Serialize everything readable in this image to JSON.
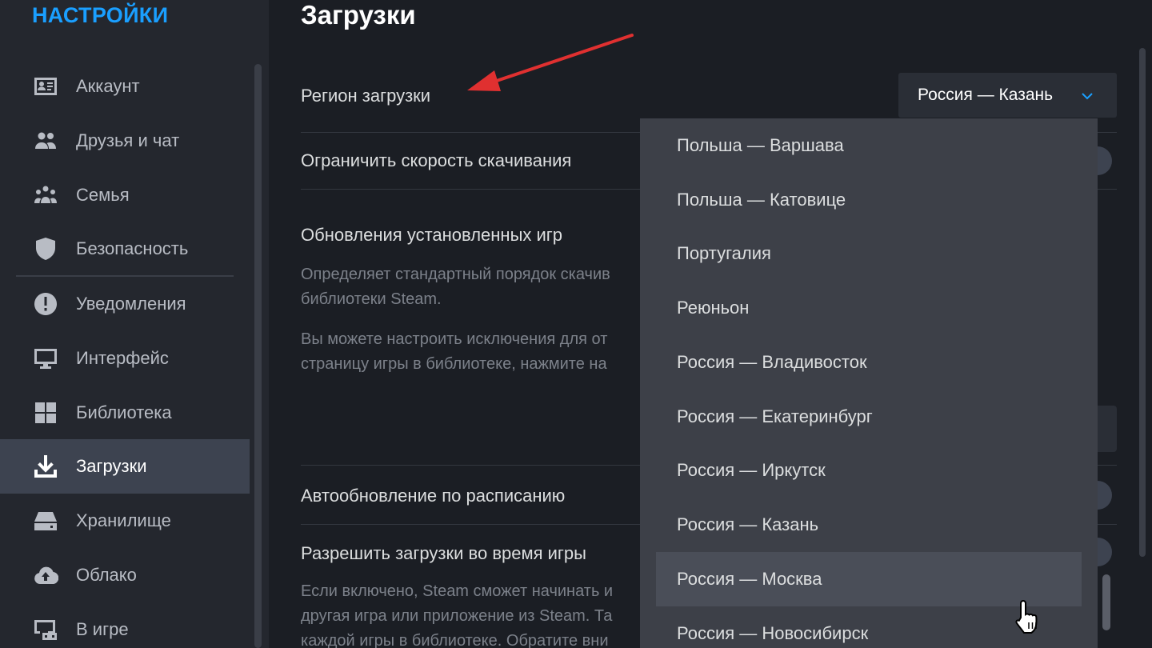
{
  "sidebar": {
    "title": "НАСТРОЙКИ",
    "items": [
      {
        "label": "Аккаунт",
        "icon": "account-card-icon"
      },
      {
        "label": "Друзья и чат",
        "icon": "friends-icon"
      },
      {
        "label": "Семья",
        "icon": "family-icon"
      },
      {
        "label": "Безопасность",
        "icon": "shield-icon"
      },
      {
        "label": "Уведомления",
        "icon": "alert-icon"
      },
      {
        "label": "Интерфейс",
        "icon": "monitor-icon"
      },
      {
        "label": "Библиотека",
        "icon": "grid-icon"
      },
      {
        "label": "Загрузки",
        "icon": "download-icon",
        "active": true
      },
      {
        "label": "Хранилище",
        "icon": "drive-icon"
      },
      {
        "label": "Облако",
        "icon": "cloud-icon"
      },
      {
        "label": "В игре",
        "icon": "ingame-icon"
      }
    ]
  },
  "main": {
    "title": "Загрузки",
    "region_label": "Регион загрузки",
    "region_value": "Россия — Казань",
    "limit_speed_label": "Ограничить скорость скачивания",
    "updates_label": "Обновления установленных игр",
    "updates_desc_1": [
      "Определяет стандартный порядок скачив",
      "библиотеки Steam."
    ],
    "updates_desc_2": [
      "Вы можете настроить исключения для от",
      "страницу игры в библиотеке, нажмите на"
    ],
    "auto_update_label": "Автообновление по расписанию",
    "allow_downloads_label": "Разрешить загрузки во время игры",
    "allow_desc": [
      "Если включено, Steam сможет начинать и",
      "другая игра или приложение из Steam. Та",
      "каждой игры в библиотеке. Обратите вни"
    ]
  },
  "dropdown": {
    "options": [
      "Польша — Варшава",
      "Польша — Катовице",
      "Португалия",
      "Реюньон",
      "Россия — Владивосток",
      "Россия — Екатеринбург",
      "Россия — Иркутск",
      "Россия — Казань",
      "Россия — Москва",
      "Россия — Новосибирск"
    ],
    "hovered": "Россия — Москва"
  },
  "colors": {
    "accent": "#1a9fff",
    "annotation_arrow": "#e03030"
  }
}
